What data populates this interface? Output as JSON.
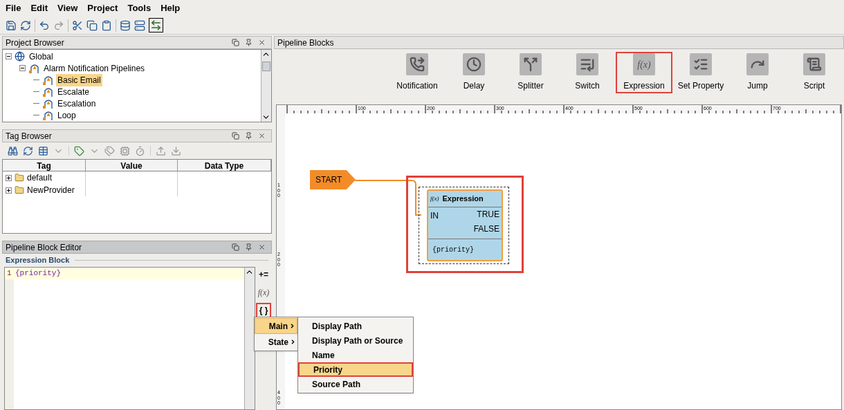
{
  "menu_bar": [
    "File",
    "Edit",
    "View",
    "Project",
    "Tools",
    "Help"
  ],
  "project_browser": {
    "title": "Project Browser",
    "tree": [
      {
        "label": "Global",
        "kind": "global",
        "expanded": true,
        "selected": false,
        "children": [
          {
            "label": "Alarm Notification Pipelines",
            "kind": "pipeline",
            "expanded": true,
            "selected": false,
            "children": [
              {
                "label": "Basic Email",
                "kind": "pipeline",
                "selected": true
              },
              {
                "label": "Escalate",
                "kind": "pipeline",
                "selected": false
              },
              {
                "label": "Escalation",
                "kind": "pipeline",
                "selected": false
              },
              {
                "label": "Loop",
                "kind": "pipeline",
                "selected": false
              }
            ]
          }
        ]
      }
    ]
  },
  "tag_browser": {
    "title": "Tag Browser",
    "columns": [
      "Tag",
      "Value",
      "Data Type"
    ],
    "rows": [
      {
        "tag": "default",
        "expanded": false
      },
      {
        "tag": "NewProvider",
        "expanded": false
      }
    ]
  },
  "block_editor": {
    "title": "Pipeline Block Editor",
    "section": "Expression Block",
    "lines": [
      {
        "number": "1",
        "code": "{priority}"
      }
    ],
    "tools": [
      {
        "label": "+=",
        "highlighted": false
      },
      {
        "label": "f(x)",
        "highlighted": false
      },
      {
        "label": "{ }",
        "highlighted": true
      }
    ]
  },
  "pipeline_blocks": {
    "title": "Pipeline Blocks",
    "palette": [
      {
        "label": "Notification",
        "kind": "notification",
        "highlighted": false
      },
      {
        "label": "Delay",
        "kind": "delay",
        "highlighted": false
      },
      {
        "label": "Splitter",
        "kind": "splitter",
        "highlighted": false
      },
      {
        "label": "Switch",
        "kind": "switch",
        "highlighted": false
      },
      {
        "label": "Expression",
        "kind": "expression",
        "glyph": "f(x)",
        "highlighted": true
      },
      {
        "label": "Set Property",
        "kind": "set_property",
        "highlighted": false
      },
      {
        "label": "Jump",
        "kind": "jump",
        "highlighted": false
      },
      {
        "label": "Script",
        "kind": "script",
        "highlighted": false
      }
    ],
    "ruler": {
      "x_labels": [
        "100",
        "200",
        "300",
        "400",
        "500",
        "600",
        "700"
      ],
      "y_labels": [
        "100",
        "200",
        "400"
      ]
    },
    "canvas": {
      "start": {
        "label": "START"
      },
      "node": {
        "glyph": "f(x)",
        "title": "Expression",
        "input": "IN",
        "outputs": [
          "TRUE",
          "FALSE"
        ],
        "expression": "{priority}",
        "selected": true,
        "highlighted": true
      }
    }
  },
  "context_menu": {
    "items": [
      {
        "label": "Main",
        "selected": true
      },
      {
        "label": "State",
        "selected": false
      }
    ],
    "submenu": [
      {
        "label": "Display Path",
        "selected": false
      },
      {
        "label": "Display Path or Source",
        "selected": false
      },
      {
        "label": "Name",
        "selected": false
      },
      {
        "label": "Priority",
        "selected": true
      },
      {
        "label": "Source Path",
        "selected": false
      }
    ]
  }
}
